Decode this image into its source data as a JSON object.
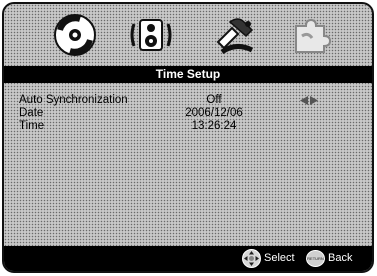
{
  "menu": {
    "icons": [
      "disc-icon",
      "audio-speaker-icon",
      "tools-icon",
      "puzzle-icon"
    ],
    "title": "Time Setup"
  },
  "settings": [
    {
      "label": "Auto Synchronization",
      "value": "Off"
    },
    {
      "label": "Date",
      "value": "2006/12/06"
    },
    {
      "label": "Time",
      "value": "13:26:24"
    }
  ],
  "footer": {
    "select_label": "Select",
    "back_label": "Back",
    "back_button_text": "RETURN"
  }
}
